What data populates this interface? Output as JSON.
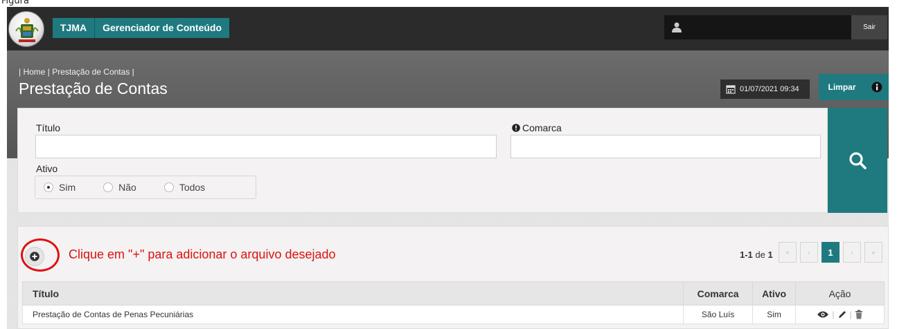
{
  "figure_label": "Figura",
  "header": {
    "brand_short": "TJMA",
    "brand_title": "Gerenciador de Conteúdo",
    "logout_label": "Sair"
  },
  "page": {
    "breadcrumb": "| Home | Prestação de Contas |",
    "title": "Prestação de Contas",
    "datetime": "01/07/2021 09:34",
    "clear_label": "Limpar"
  },
  "filter": {
    "title_label": "Título",
    "title_value": "",
    "comarca_label": "Comarca",
    "comarca_value": "",
    "active_label": "Ativo",
    "options": [
      "Sim",
      "Não",
      "Todos"
    ],
    "selected": "Sim"
  },
  "results": {
    "hint": "Clique em \"+\" para adicionar o arquivo desejado",
    "range": "1-1",
    "of_word": "de",
    "total": "1",
    "pager": {
      "first": "«",
      "prev": "‹",
      "current": "1",
      "next": "›",
      "last": "»"
    },
    "columns": [
      "Título",
      "Comarca",
      "Ativo",
      "Ação"
    ],
    "rows": [
      {
        "titulo": "Prestação de Contas de Penas Pecuniárias",
        "comarca": "São Luís",
        "ativo": "Sim"
      }
    ]
  },
  "colors": {
    "accent": "#1f7a80",
    "topbar": "#2b2b2b",
    "annotation": "#dd1111"
  }
}
